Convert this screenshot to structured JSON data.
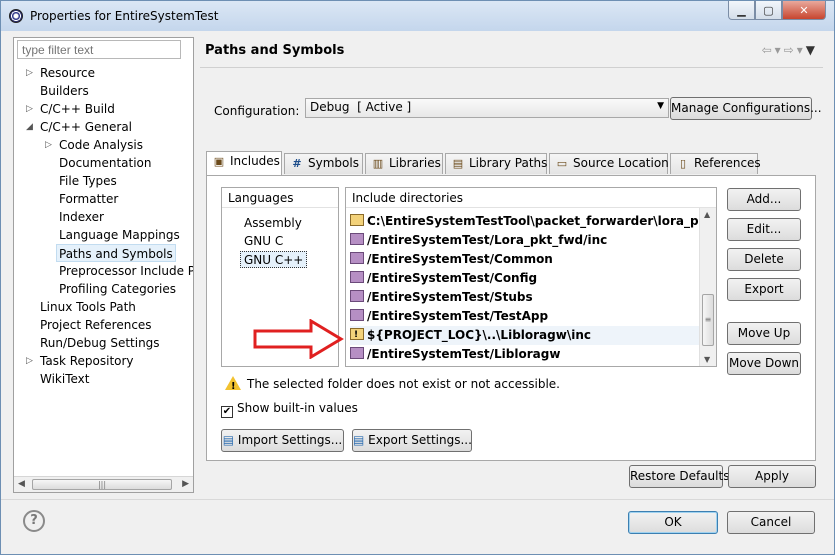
{
  "window": {
    "title": "Properties for EntireSystemTest"
  },
  "filter": {
    "placeholder": "type filter text"
  },
  "tree": [
    {
      "label": "Resource",
      "expand": "collapsed",
      "level": 0
    },
    {
      "label": "Builders",
      "expand": "none",
      "level": 0
    },
    {
      "label": "C/C++ Build",
      "expand": "collapsed",
      "level": 0
    },
    {
      "label": "C/C++ General",
      "expand": "expanded",
      "level": 0
    },
    {
      "label": "Code Analysis",
      "expand": "collapsed",
      "level": 1
    },
    {
      "label": "Documentation",
      "expand": "none",
      "level": 1
    },
    {
      "label": "File Types",
      "expand": "none",
      "level": 1
    },
    {
      "label": "Formatter",
      "expand": "none",
      "level": 1
    },
    {
      "label": "Indexer",
      "expand": "none",
      "level": 1
    },
    {
      "label": "Language Mappings",
      "expand": "none",
      "level": 1
    },
    {
      "label": "Paths and Symbols",
      "expand": "none",
      "level": 1,
      "selected": true
    },
    {
      "label": "Preprocessor Include Pa",
      "expand": "none",
      "level": 1
    },
    {
      "label": "Profiling Categories",
      "expand": "none",
      "level": 1
    },
    {
      "label": "Linux Tools Path",
      "expand": "none",
      "level": 0
    },
    {
      "label": "Project References",
      "expand": "none",
      "level": 0
    },
    {
      "label": "Run/Debug Settings",
      "expand": "none",
      "level": 0
    },
    {
      "label": "Task Repository",
      "expand": "collapsed",
      "level": 0
    },
    {
      "label": "WikiText",
      "expand": "none",
      "level": 0
    }
  ],
  "page": {
    "title": "Paths and Symbols"
  },
  "configuration": {
    "label": "Configuration:",
    "value": "Debug  [ Active ]",
    "manage_label": "Manage Configurations..."
  },
  "tabs": [
    {
      "label": "Includes",
      "icon": "includes-icon",
      "active": true
    },
    {
      "label": "Symbols",
      "icon": "hash-icon"
    },
    {
      "label": "Libraries",
      "icon": "library-icon"
    },
    {
      "label": "Library Paths",
      "icon": "library-path-icon"
    },
    {
      "label": "Source Location",
      "icon": "source-folder-icon"
    },
    {
      "label": "References",
      "icon": "references-icon"
    }
  ],
  "languages": {
    "header": "Languages",
    "items": [
      "Assembly",
      "GNU C",
      "GNU C++"
    ],
    "selected": "GNU C++"
  },
  "includes": {
    "header": "Include directories",
    "items": [
      {
        "path": "C:\\EntireSystemTestTool\\packet_forwarder\\lora_pkt_fw...",
        "kind": "folder"
      },
      {
        "path": "/EntireSystemTest/Lora_pkt_fwd/inc",
        "kind": "project"
      },
      {
        "path": "/EntireSystemTest/Common",
        "kind": "project"
      },
      {
        "path": "/EntireSystemTest/Config",
        "kind": "project"
      },
      {
        "path": "/EntireSystemTest/Stubs",
        "kind": "project"
      },
      {
        "path": "/EntireSystemTest/TestApp",
        "kind": "project"
      },
      {
        "path": "${PROJECT_LOC}\\..\\Libloragw\\inc",
        "kind": "warning",
        "selected": true
      },
      {
        "path": "/EntireSystemTest/Libloragw",
        "kind": "project"
      }
    ]
  },
  "side_buttons": [
    "Add...",
    "Edit...",
    "Delete",
    "Export",
    "Move Up",
    "Move Down"
  ],
  "warning": "The selected folder does not exist or not accessible.",
  "show_builtin": {
    "label": "Show built-in values",
    "checked": true
  },
  "import_label": "Import Settings...",
  "export_settings_label": "Export Settings...",
  "restore_label": "Restore Defaults",
  "apply_label": "Apply",
  "ok_label": "OK",
  "cancel_label": "Cancel",
  "colors": {
    "annotation_arrow": "#e02020",
    "selection": "#e5f1fb",
    "folder": "#f3d27a"
  }
}
